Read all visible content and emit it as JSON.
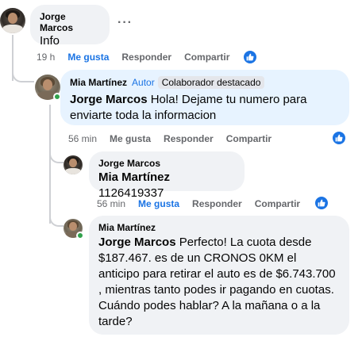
{
  "comment1": {
    "author": "Jorge Marcos",
    "text": "Info",
    "time": "19 h",
    "like_label": "Me gusta",
    "reply_label": "Responder",
    "share_label": "Compartir",
    "liked": true
  },
  "comment2": {
    "author": "Mia Martínez",
    "author_badge": "Autor",
    "top_badge": "Colaborador destacado",
    "mention": "Jorge Marcos",
    "text": " Hola! Dejame tu numero para enviarte toda la informacion",
    "time": "56 min",
    "like_label": "Me gusta",
    "reply_label": "Responder",
    "share_label": "Compartir",
    "liked": false
  },
  "comment3": {
    "author": "Jorge Marcos",
    "mention": "Mia Martínez",
    "text": " 1126419337",
    "time": "56 min",
    "like_label": "Me gusta",
    "reply_label": "Responder",
    "share_label": "Compartir",
    "liked": true
  },
  "comment4": {
    "author": "Mia Martínez",
    "mention": "Jorge Marcos",
    "text": " Perfecto! La cuota desde $187.467. es de un CRONOS 0KM el anticipo para retirar el auto es de $6.743.700 , mientras tanto podes ir pagando en cuotas. Cuándo podes hablar? A la mañana o a la tarde?"
  },
  "icons": {
    "more": "more-options-icon",
    "like": "thumbs-up-icon"
  },
  "colors": {
    "accent": "#1b74e4",
    "bubble": "#f0f2f5",
    "author_bubble": "#e7f3ff",
    "online": "#31a24c"
  }
}
